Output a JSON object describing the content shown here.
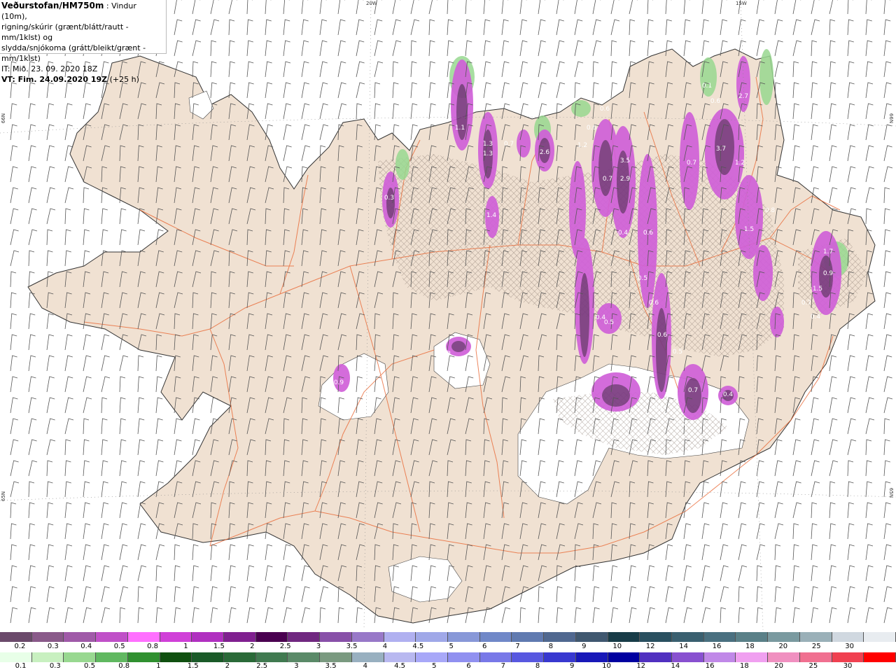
{
  "header": {
    "title_strong": "Veðurstofan/HM750m",
    "title_rest": " : Vindur (10m),",
    "line2": "rigning/skúrir (grænt/blátt/rautt - mm/1klst) og",
    "line3": "slydda/snjókoma (grátt/bleikt/grænt - mm/1klst)",
    "it": "IT: Mið. 23. 09. 2020 18Z",
    "vt_strong": "VT: Fim. 24.09.2020 19Z",
    "vt_rest": " (+25 h)"
  },
  "grid_labels": {
    "top_20w": "20W",
    "top_15w": "15W",
    "left_66n": "66N",
    "left_65n": "65N",
    "right_66n": "66N",
    "right_65n": "65N"
  },
  "map_values": [
    {
      "label": "0.3"
    },
    {
      "label": "1.1"
    },
    {
      "label": "1.3"
    },
    {
      "label": "0.7"
    },
    {
      "label": "2.6"
    },
    {
      "label": "0.6"
    },
    {
      "label": "1.2"
    },
    {
      "label": "3.5"
    },
    {
      "label": "2.9"
    },
    {
      "label": "0.7"
    },
    {
      "label": "0.4"
    },
    {
      "label": "0.6"
    },
    {
      "label": "0.5"
    },
    {
      "label": "0.6"
    },
    {
      "label": "3.7"
    },
    {
      "label": "1.2"
    },
    {
      "label": "0.7"
    },
    {
      "label": "1.5"
    },
    {
      "label": "1.7"
    },
    {
      "label": "0.9"
    },
    {
      "label": "1.5"
    },
    {
      "label": "0.7"
    },
    {
      "label": "0.4"
    },
    {
      "label": "0.3"
    },
    {
      "label": "0.9"
    },
    {
      "label": "0.4"
    },
    {
      "label": "0.5"
    },
    {
      "label": "0.6"
    },
    {
      "label": "0.5"
    },
    {
      "label": "0.4"
    },
    {
      "label": "0.7"
    },
    {
      "label": "0.2"
    },
    {
      "label": "0.4"
    },
    {
      "label": "0.1"
    },
    {
      "label": "0.6"
    },
    {
      "label": "2.7"
    },
    {
      "label": "0.8"
    },
    {
      "label": "0.6"
    },
    {
      "label": "1.3"
    },
    {
      "label": "1.4"
    }
  ],
  "legend_top": {
    "colors": [
      "#6b4a6b",
      "#8a5a8a",
      "#a05aa8",
      "#c050c8",
      "#ff70ff",
      "#d040d8",
      "#b030c0",
      "#802090",
      "#4a0050",
      "#702880",
      "#8850a8",
      "#9878c8",
      "#b0b0f0",
      "#a0a8e8",
      "#8898d8",
      "#7088c8",
      "#607ab0",
      "#506890",
      "#405870",
      "#183c48",
      "#2a5060",
      "#3a6070",
      "#4a7080",
      "#5a8088",
      "#7a9aa0",
      "#9ab0b8",
      "#d0d8e0",
      "#e8ecf0"
    ],
    "labels": [
      "0.2",
      "0.3",
      "0.4",
      "0.5",
      "0.8",
      "1",
      "1.5",
      "2",
      "2.5",
      "3",
      "3.5",
      "4",
      "4.5",
      "5",
      "6",
      "7",
      "8",
      "9",
      "10",
      "12",
      "14",
      "16",
      "18",
      "20",
      "25",
      "30"
    ]
  },
  "legend_bottom": {
    "colors": [
      "#e8ffe8",
      "#c8f0c0",
      "#98d890",
      "#60b860",
      "#309030",
      "#105010",
      "#1a5a28",
      "#2a6a38",
      "#407a50",
      "#5a8a68",
      "#7a9a80",
      "#98b0c0",
      "#b8b8f0",
      "#a8a8f8",
      "#9090f0",
      "#7878e8",
      "#5858e0",
      "#3838d0",
      "#1818b8",
      "#0000a0",
      "#5030c0",
      "#8850d0",
      "#c088e8",
      "#f0a0f0",
      "#f090c0",
      "#f07090",
      "#f04050",
      "#ff0000"
    ],
    "labels": [
      "0.1",
      "0.3",
      "0.5",
      "0.8",
      "1",
      "1.5",
      "2",
      "2.5",
      "3",
      "3.5",
      "4",
      "4.5",
      "5",
      "6",
      "7",
      "8",
      "9",
      "10",
      "12",
      "14",
      "16",
      "18",
      "20",
      "25",
      "30"
    ]
  },
  "colors": {
    "land": "#f0e1d2",
    "glacier": "#ffffff",
    "roads": "#e8602a",
    "wind_barbs": "#555555",
    "snow_hatch": "#8a7a70"
  }
}
